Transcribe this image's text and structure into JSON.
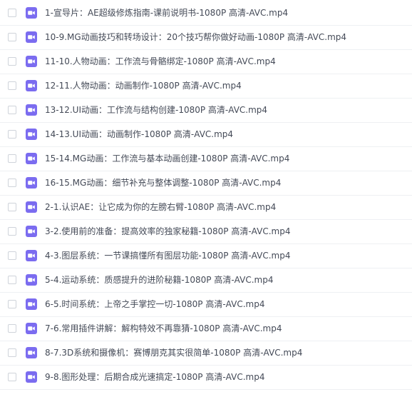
{
  "icon": "video-file-icon",
  "accent_color": "#7b6cf0",
  "files": [
    {
      "name": "1-宣导片：AE超级修炼指南-课前说明书-1080P 高清-AVC.mp4"
    },
    {
      "name": "10-9.MG动画技巧和转场设计：20个技巧帮你做好动画-1080P 高清-AVC.mp4"
    },
    {
      "name": "11-10.人物动画：工作流与骨骼绑定-1080P 高清-AVC.mp4"
    },
    {
      "name": "12-11.人物动画：动画制作-1080P 高清-AVC.mp4"
    },
    {
      "name": "13-12.UI动画：工作流与结构创建-1080P 高清-AVC.mp4"
    },
    {
      "name": "14-13.UI动画：动画制作-1080P 高清-AVC.mp4"
    },
    {
      "name": "15-14.MG动画：工作流与基本动画创建-1080P 高清-AVC.mp4"
    },
    {
      "name": "16-15.MG动画：细节补充与整体调整-1080P 高清-AVC.mp4"
    },
    {
      "name": "2-1.认识AE：让它成为你的左膀右臂-1080P 高清-AVC.mp4"
    },
    {
      "name": "3-2.使用前的准备：提高效率的独家秘籍-1080P 高清-AVC.mp4"
    },
    {
      "name": "4-3.图层系统：一节课搞懂所有图层功能-1080P 高清-AVC.mp4"
    },
    {
      "name": "5-4.运动系统：质感提升的进阶秘籍-1080P 高清-AVC.mp4"
    },
    {
      "name": "6-5.时间系统：上帝之手掌控一切-1080P 高清-AVC.mp4"
    },
    {
      "name": "7-6.常用插件讲解：解构特效不再靠猜-1080P 高清-AVC.mp4"
    },
    {
      "name": "8-7.3D系统和摄像机：赛博朋克其实很简单-1080P 高清-AVC.mp4"
    },
    {
      "name": "9-8.图形处理：后期合成光速搞定-1080P 高清-AVC.mp4"
    }
  ]
}
